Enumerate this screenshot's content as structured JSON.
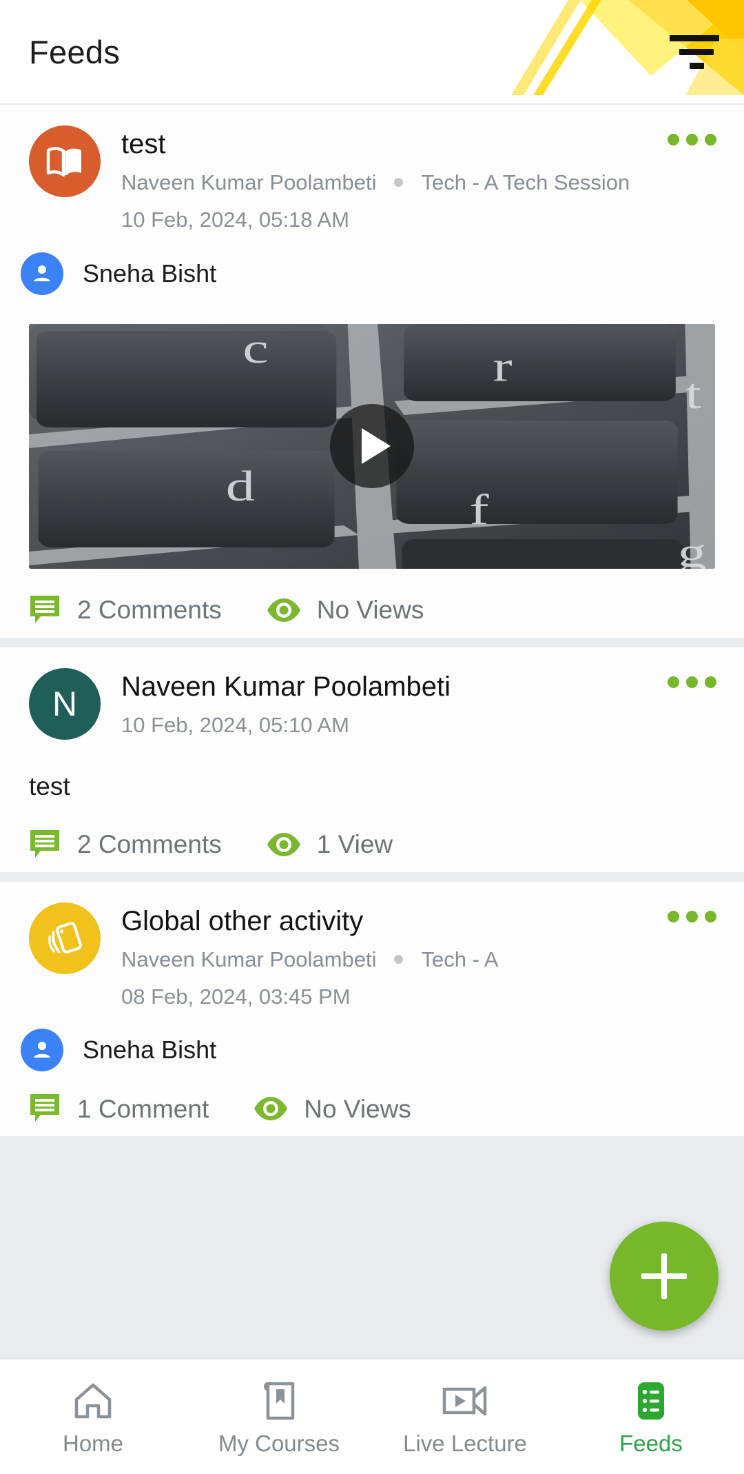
{
  "header": {
    "title": "Feeds",
    "menu_icon": "filter-menu-icon"
  },
  "posts": [
    {
      "id": "post-1",
      "avatar": {
        "type": "icon",
        "icon": "open-book-icon",
        "color": "#d95c2c"
      },
      "title": "test",
      "author": "Naveen Kumar Poolambeti",
      "course": "Tech - A Tech Session",
      "date": "10 Feb, 2024, 05:18 AM",
      "tagged_user": "Sneha Bisht",
      "has_media": true,
      "media_kind": "video",
      "comments_label": "2 Comments",
      "views_label": "No Views",
      "menu_icon": "more-options-icon"
    },
    {
      "id": "post-2",
      "avatar": {
        "type": "initial",
        "initial": "N",
        "color": "#1f5f58"
      },
      "title": "Naveen Kumar Poolambeti",
      "author": "",
      "course": "",
      "date": "10 Feb, 2024, 05:10 AM",
      "body": "test",
      "tagged_user": "",
      "has_media": false,
      "comments_label": "2 Comments",
      "views_label": "1 View",
      "menu_icon": "more-options-icon"
    },
    {
      "id": "post-3",
      "avatar": {
        "type": "icon",
        "icon": "activity-card-icon",
        "color": "#f2c21c"
      },
      "title": "Global other  activity",
      "author": "Naveen Kumar Poolambeti",
      "course": "Tech - A",
      "date": "08 Feb, 2024, 03:45 PM",
      "tagged_user": "Sneha Bisht",
      "has_media": false,
      "comments_label": "1 Comment",
      "views_label": "No Views",
      "menu_icon": "more-options-icon"
    }
  ],
  "fab": {
    "icon": "plus-icon",
    "color": "#76b82a"
  },
  "bottom_nav": {
    "items": [
      {
        "label": "Home",
        "icon": "home-icon",
        "active": false
      },
      {
        "label": "My Courses",
        "icon": "book-icon",
        "active": false
      },
      {
        "label": "Live Lecture",
        "icon": "video-camera-icon",
        "active": false
      },
      {
        "label": "Feeds",
        "icon": "feed-list-icon",
        "active": true
      }
    ]
  },
  "colors": {
    "accent_green": "#76b82a",
    "active_green": "#2ea349",
    "header_yellow": "#ffd000",
    "muted_text": "#868e96"
  }
}
